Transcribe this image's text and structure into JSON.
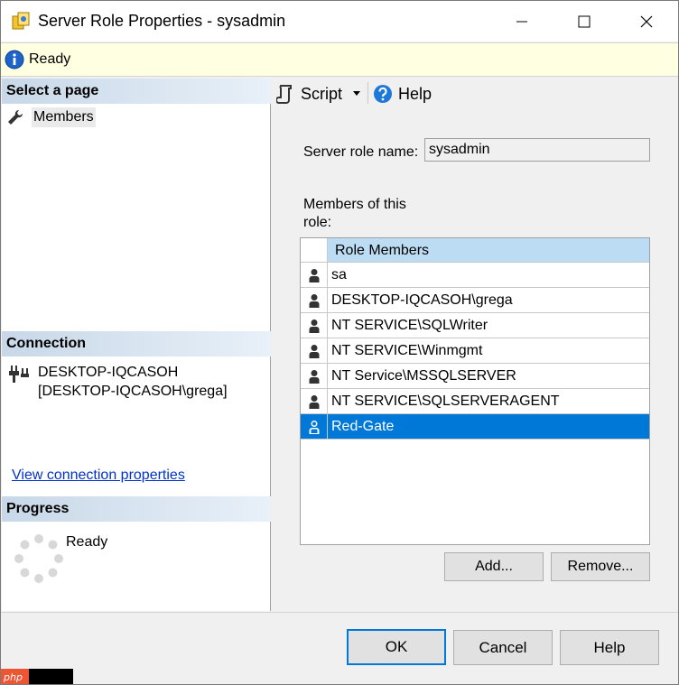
{
  "window": {
    "title": "Server Role Properties - sysadmin"
  },
  "status": {
    "text": "Ready"
  },
  "left": {
    "select_page_header": "Select a page",
    "pages": [
      {
        "label": "Members"
      }
    ],
    "connection_header": "Connection",
    "connection_server": "DESKTOP-IQCASOH",
    "connection_user": "[DESKTOP-IQCASOH\\grega]",
    "connection_link": "View connection properties",
    "progress_header": "Progress",
    "progress_status": "Ready"
  },
  "toolbar": {
    "script_label": "Script",
    "help_label": "Help"
  },
  "form": {
    "role_name_label": "Server role name:",
    "role_name_value": "sysadmin",
    "members_label": "Members of this role:"
  },
  "grid": {
    "column_header": "Role Members",
    "rows": [
      {
        "name": "sa"
      },
      {
        "name": "DESKTOP-IQCASOH\\grega"
      },
      {
        "name": "NT SERVICE\\SQLWriter"
      },
      {
        "name": "NT SERVICE\\Winmgmt"
      },
      {
        "name": "NT Service\\MSSQLSERVER"
      },
      {
        "name": "NT SERVICE\\SQLSERVERAGENT"
      },
      {
        "name": "Red-Gate"
      }
    ],
    "selected_index": 6
  },
  "buttons": {
    "add": "Add...",
    "remove": "Remove...",
    "ok": "OK",
    "cancel": "Cancel",
    "help": "Help"
  },
  "watermark": {
    "text": "php"
  },
  "colors": {
    "selection": "#0078d7",
    "status_bg": "#ffffe1",
    "header_blue": "#bcdcf4"
  }
}
